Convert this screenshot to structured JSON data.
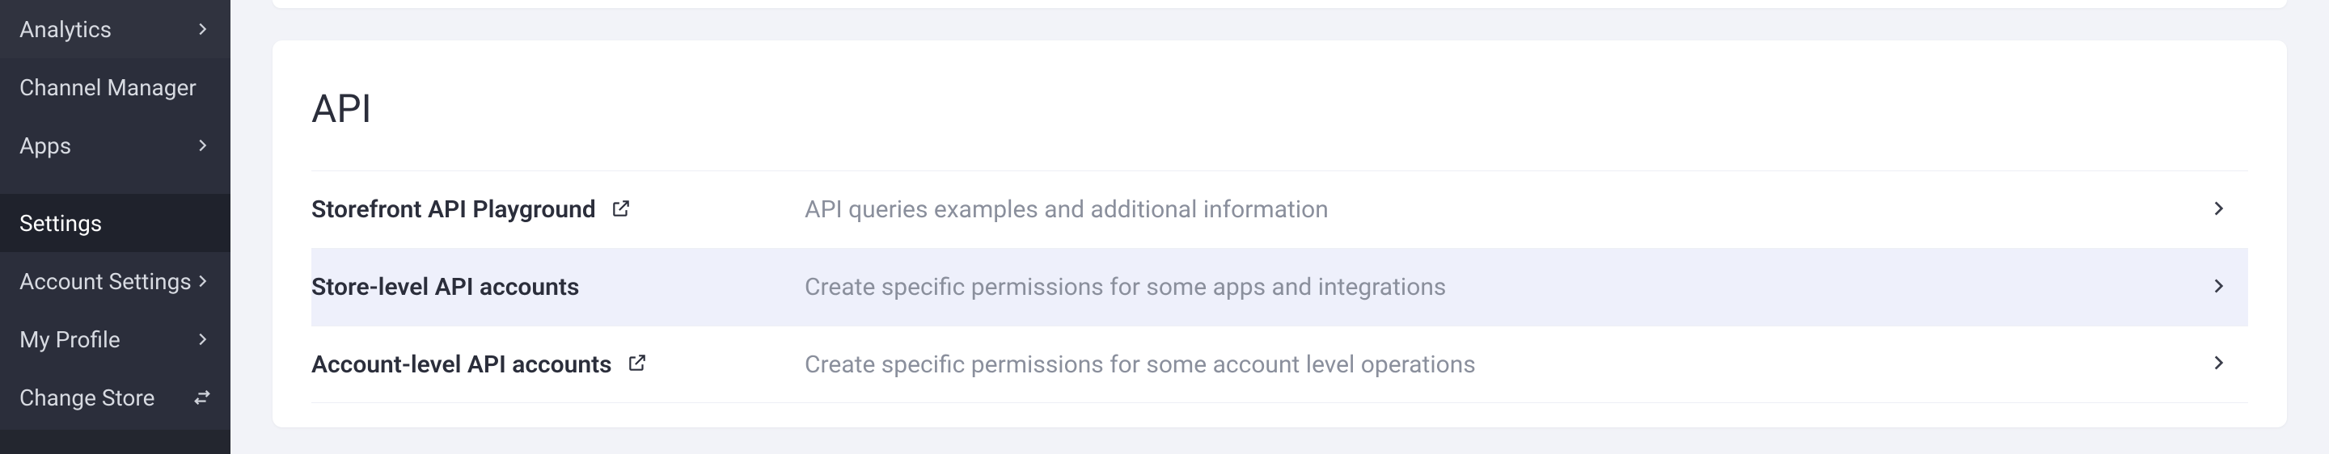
{
  "sidebar": {
    "items": [
      {
        "label": "Analytics",
        "icon": "chevron-right"
      },
      {
        "label": "Channel Manager",
        "icon": null
      },
      {
        "label": "Apps",
        "icon": "chevron-right"
      }
    ],
    "settings_label": "Settings",
    "lower_items": [
      {
        "label": "Account Settings",
        "icon": "chevron-right"
      },
      {
        "label": "My Profile",
        "icon": "chevron-right"
      },
      {
        "label": "Change Store",
        "icon": "swap"
      }
    ]
  },
  "card": {
    "title": "API",
    "rows": [
      {
        "title": "Storefront API Playground",
        "has_external": true,
        "desc": "API queries examples and additional information",
        "highlight": false
      },
      {
        "title": "Store-level API accounts",
        "has_external": false,
        "desc": "Create specific permissions for some apps and integrations",
        "highlight": true
      },
      {
        "title": "Account-level API accounts",
        "has_external": true,
        "desc": "Create specific permissions for some account level operations",
        "highlight": false
      }
    ]
  }
}
